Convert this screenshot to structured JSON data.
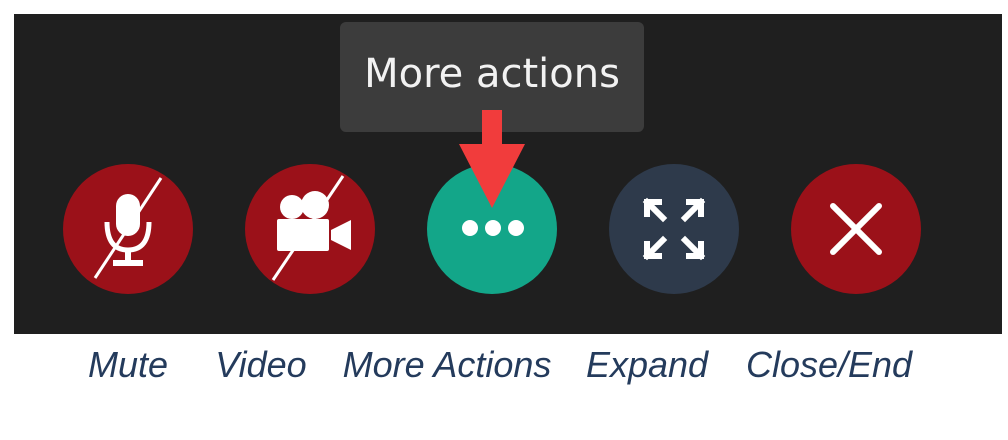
{
  "tooltip": {
    "text": "More actions"
  },
  "controls": {
    "mute": {
      "caption": "Mute",
      "icon": "microphone-muted-icon",
      "color": "#9b1119"
    },
    "video": {
      "caption": "Video",
      "icon": "video-camera-off-icon",
      "color": "#9b1119"
    },
    "more": {
      "caption": "More Actions",
      "icon": "ellipsis-icon",
      "color": "#13a689"
    },
    "expand": {
      "caption": "Expand",
      "icon": "expand-icon",
      "color": "#2e3a4b"
    },
    "close": {
      "caption": "Close/End",
      "icon": "close-icon",
      "color": "#9b1119"
    }
  },
  "annotation": {
    "arrow_color": "#f13c3c",
    "icon": "pointer-arrow-icon"
  },
  "bar_color": "#1f1f1f",
  "caption_color": "#243b5c"
}
